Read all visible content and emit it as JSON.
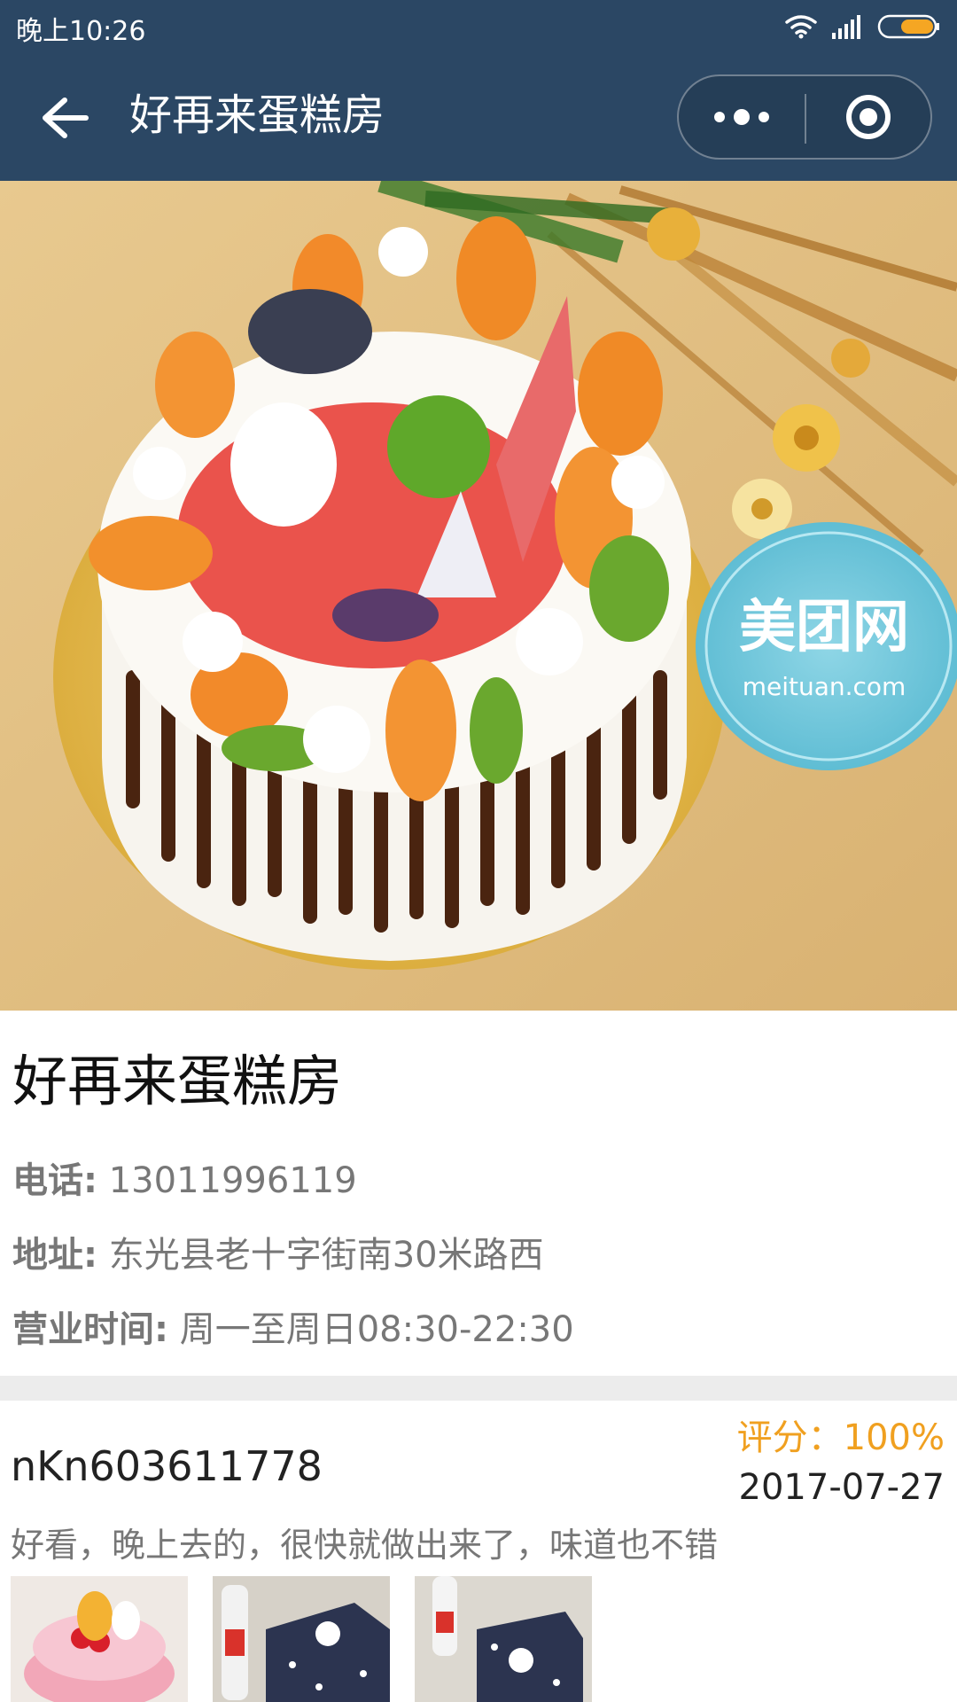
{
  "status_bar": {
    "time": "晚上10:26",
    "icons": [
      "wifi-icon",
      "signal-icon",
      "battery-icon"
    ]
  },
  "nav": {
    "title": "好再来蛋糕房",
    "icons": [
      "back-arrow-icon",
      "more-dots-icon",
      "close-target-icon"
    ]
  },
  "hero": {
    "watermark_brand": "美团网",
    "watermark_url": "meituan.com"
  },
  "shop": {
    "name": "好再来蛋糕房",
    "phone_label": "电话:",
    "phone": "13011996119",
    "address_label": "地址:",
    "address": "东光县老十字街南30米路西",
    "hours_label": "营业时间:",
    "hours": "周一至周日08:30-22:30"
  },
  "review": {
    "user": "nKn603611778",
    "score": "评分：100%",
    "date": "2017-07-27",
    "text": "好看，晚上去的，很快就做出来了，味道也不错"
  },
  "colors": {
    "header_bg": "#2b4764",
    "score_color": "#f0a020",
    "battery_color": "#f5a623"
  }
}
